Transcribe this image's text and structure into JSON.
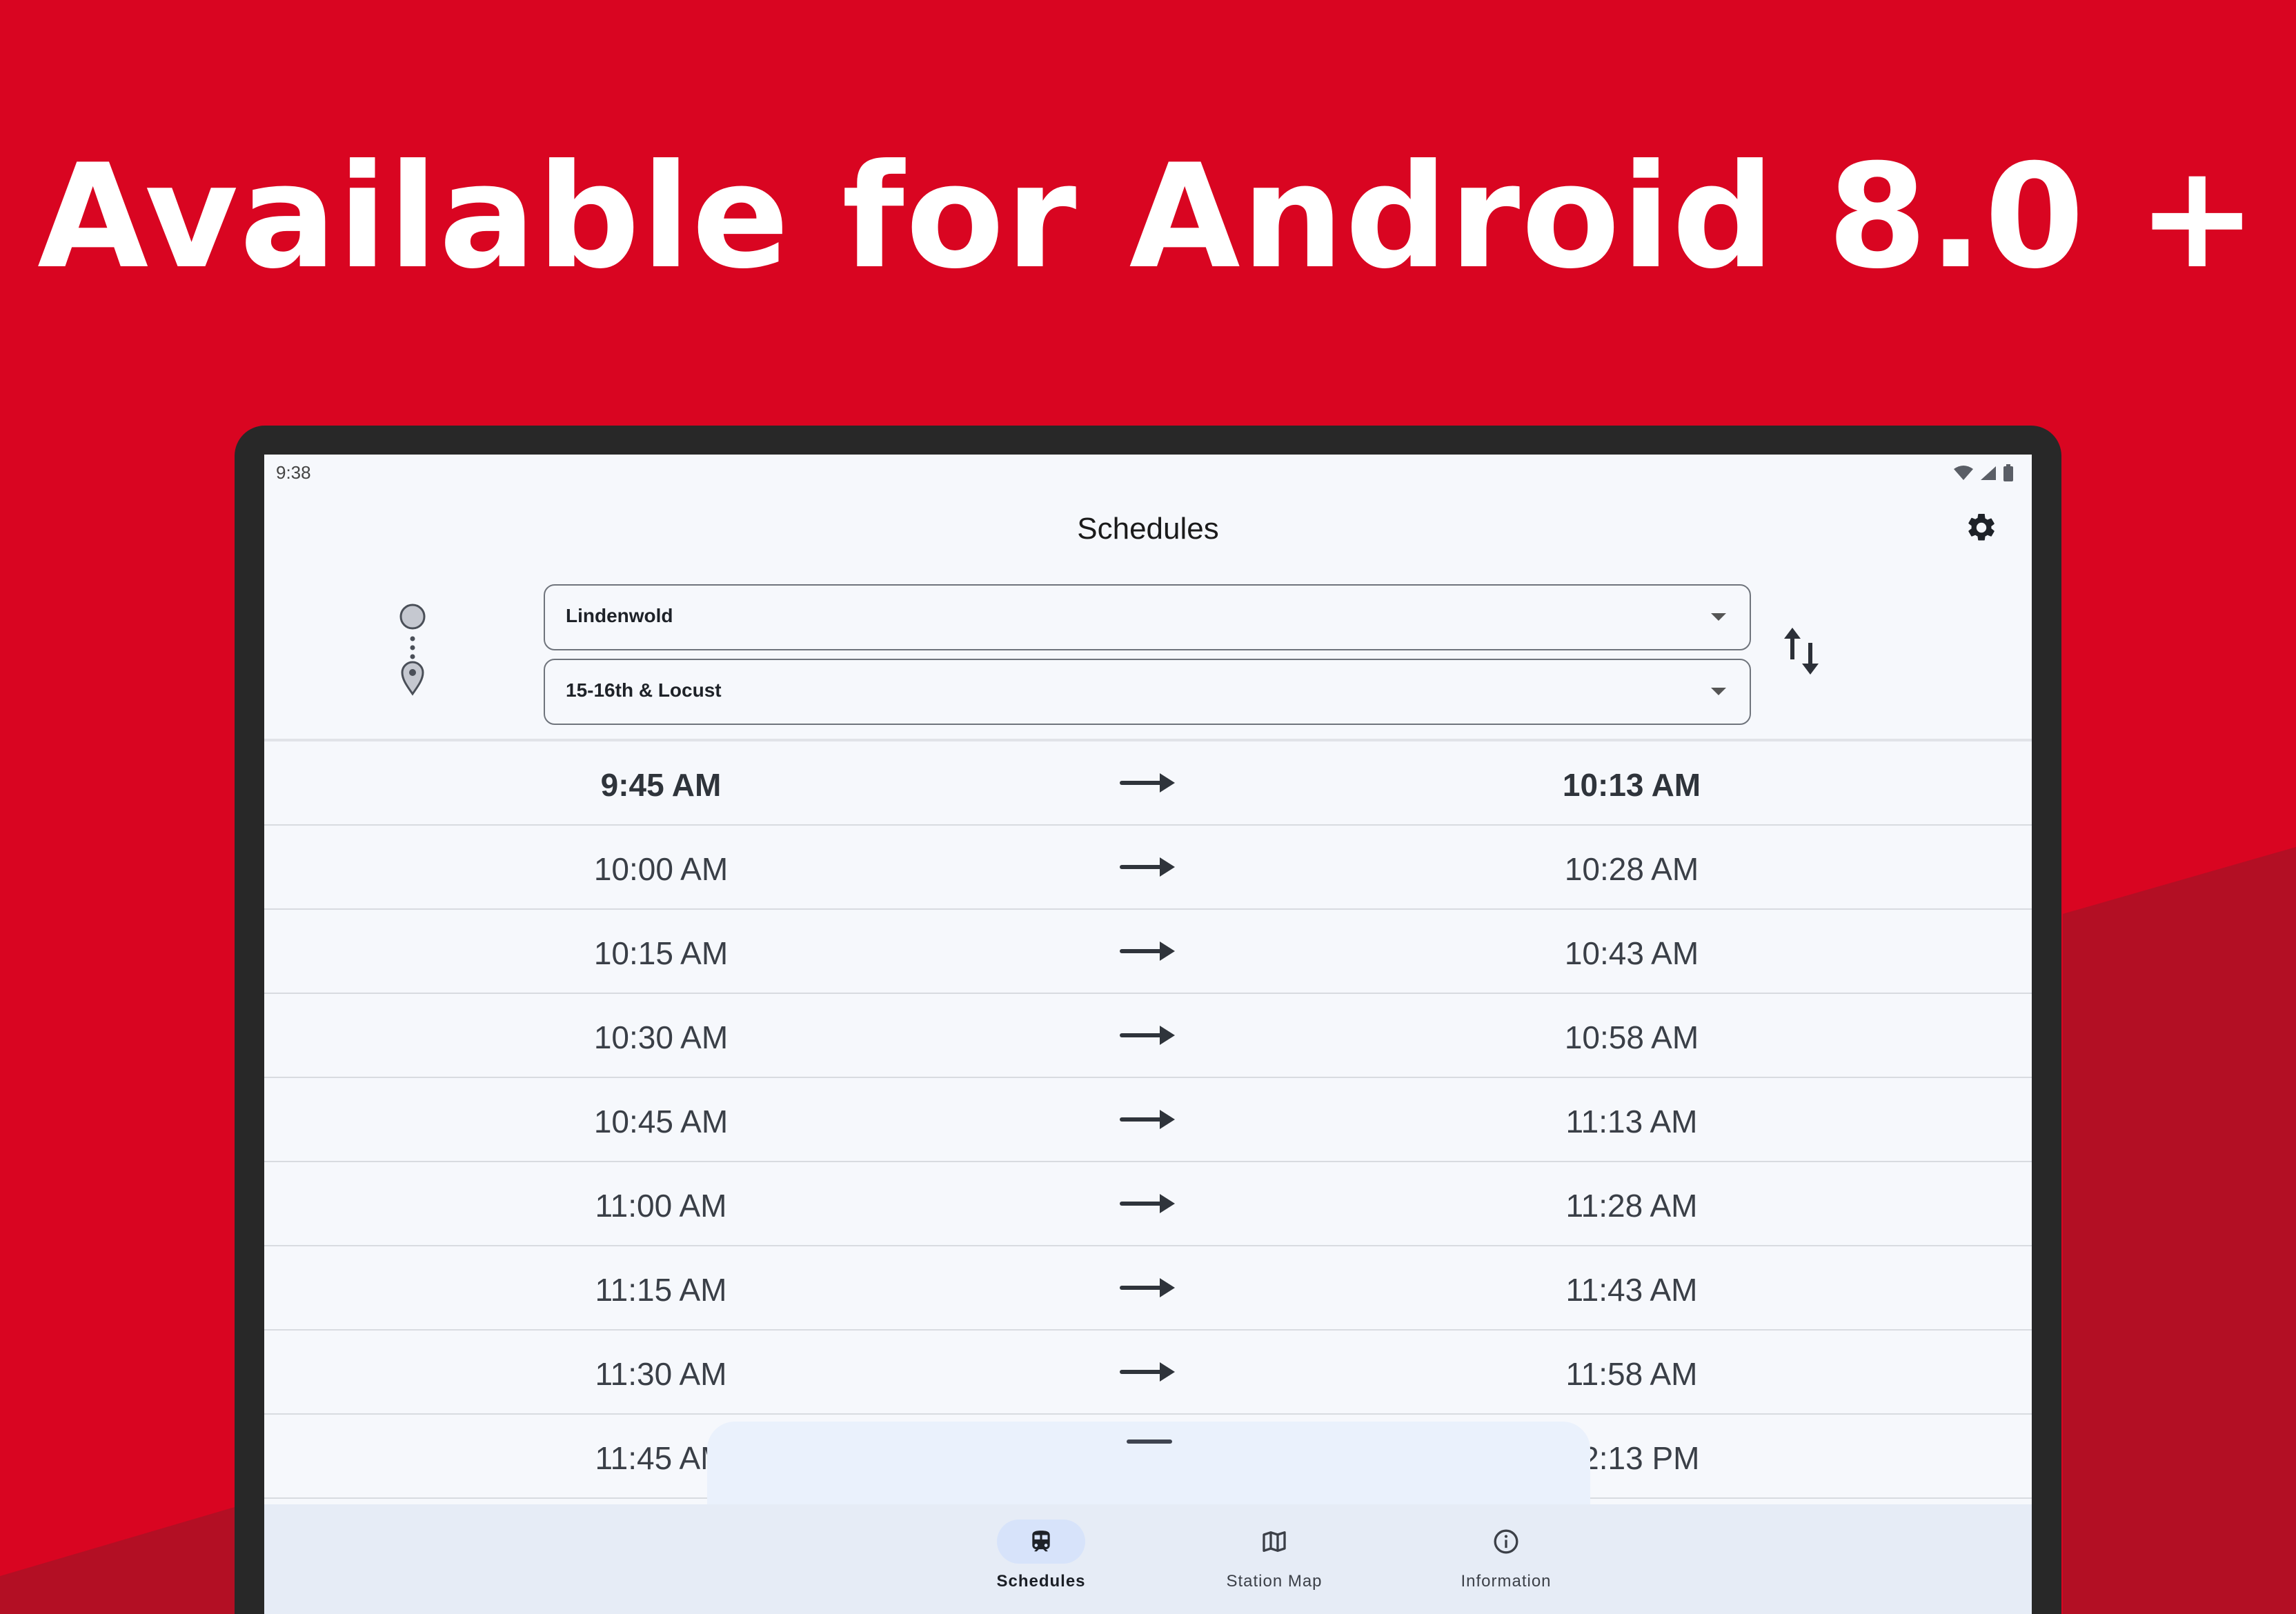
{
  "banner": {
    "headline": "Available for Android 8.0 +",
    "background_color": "#d90521",
    "shade_color": "#b30f24"
  },
  "status_bar": {
    "time": "9:38",
    "icons": [
      "wifi-icon",
      "cell-signal-icon",
      "battery-icon"
    ]
  },
  "header": {
    "title": "Schedules",
    "settings_icon": "gear-icon"
  },
  "route": {
    "origin": "Lindenwold",
    "destination": "15-16th & Locust",
    "swap_icon": "swap-vertical-icon"
  },
  "schedule": {
    "rows": [
      {
        "depart": "9:45 AM",
        "arrive": "10:13 AM"
      },
      {
        "depart": "10:00 AM",
        "arrive": "10:28 AM"
      },
      {
        "depart": "10:15 AM",
        "arrive": "10:43 AM"
      },
      {
        "depart": "10:30 AM",
        "arrive": "10:58 AM"
      },
      {
        "depart": "10:45 AM",
        "arrive": "11:13 AM"
      },
      {
        "depart": "11:00 AM",
        "arrive": "11:28 AM"
      },
      {
        "depart": "11:15 AM",
        "arrive": "11:43 AM"
      },
      {
        "depart": "11:30 AM",
        "arrive": "11:58 AM"
      },
      {
        "depart": "11:45 AM",
        "arrive": "12:13 PM"
      }
    ]
  },
  "nav": {
    "items": [
      {
        "label": "Schedules",
        "icon": "train-icon",
        "active": true
      },
      {
        "label": "Station Map",
        "icon": "map-icon",
        "active": false
      },
      {
        "label": "Information",
        "icon": "info-icon",
        "active": false
      }
    ]
  }
}
